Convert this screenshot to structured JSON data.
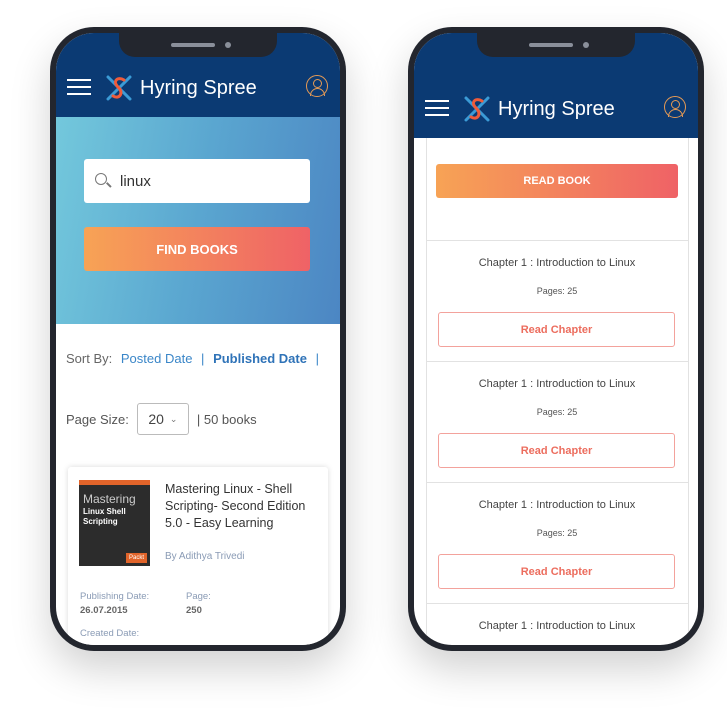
{
  "brand": {
    "name": "Hyring Spree",
    "colors": {
      "header": "#0b3a73",
      "accent_start": "#f7a355",
      "accent_end": "#ef6266",
      "link": "#3a86c8"
    }
  },
  "left": {
    "search": {
      "value": "linux",
      "icon": "search-icon"
    },
    "find_books": "FIND BOOKS",
    "sort": {
      "label": "Sort By:",
      "options": [
        "Posted Date",
        "Published Date"
      ],
      "active": "Published Date",
      "separator": "|"
    },
    "page_size": {
      "label": "Page Size:",
      "value": "20",
      "count": "| 50 books"
    },
    "book": {
      "cover": {
        "title": "Mastering",
        "subtitle": "Linux Shell Scripting",
        "publisher": "Packt"
      },
      "title": "Mastering Linux - Shell Scripting- Second Edition 5.0 - Easy Learning",
      "author": "By Adithya Trivedi",
      "publishing_date_label": "Publishing Date:",
      "publishing_date": "26.07.2015",
      "page_label": "Page:",
      "page": "250",
      "created_date_label": "Created Date:"
    }
  },
  "right": {
    "read_book": "READ BOOK",
    "chapters": [
      {
        "title": "Chapter 1 : Introduction to Linux",
        "pages": "Pages: 25",
        "button": "Read Chapter"
      },
      {
        "title": "Chapter 1 : Introduction to Linux",
        "pages": "Pages: 25",
        "button": "Read Chapter"
      },
      {
        "title": "Chapter 1 : Introduction to Linux",
        "pages": "Pages: 25",
        "button": "Read Chapter"
      },
      {
        "title": "Chapter 1 : Introduction to Linux"
      }
    ]
  }
}
